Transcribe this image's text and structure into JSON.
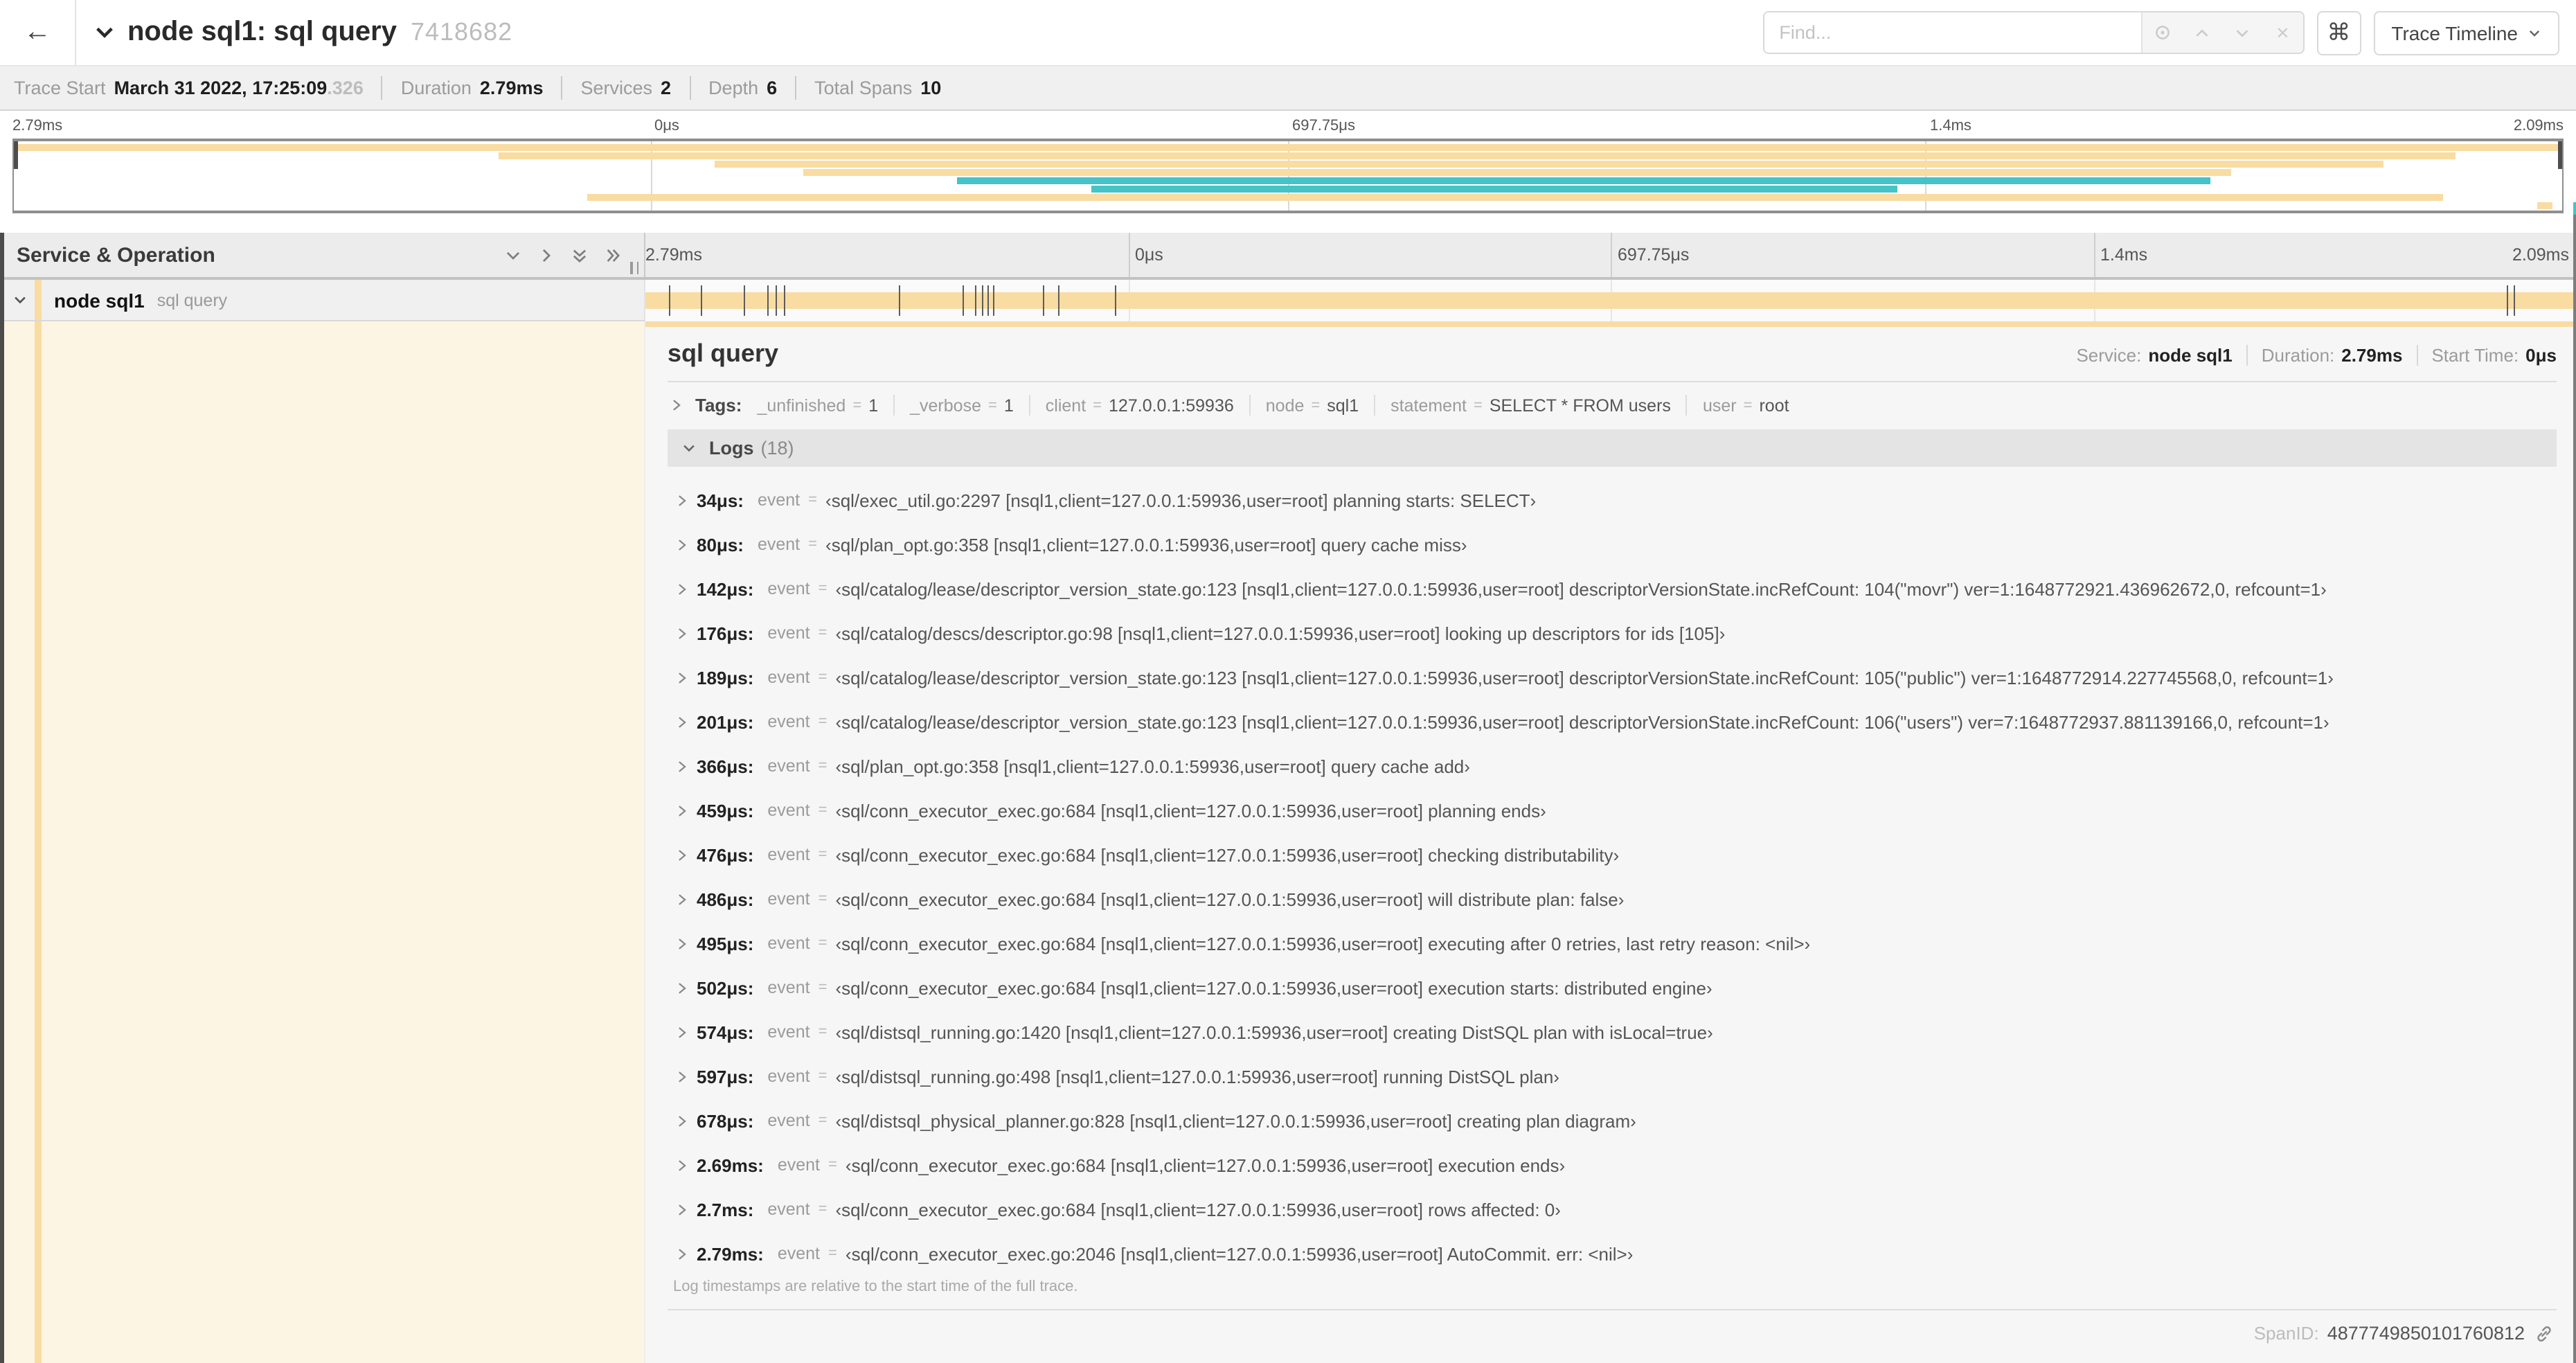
{
  "icons": {
    "back": "←",
    "command": "⌘",
    "close": "✕"
  },
  "header": {
    "title": "node sql1: sql query",
    "trace_id": "7418682",
    "find_placeholder": "Find...",
    "view_selector_label": "Trace Timeline"
  },
  "summary": {
    "items": [
      {
        "label": "Trace Start",
        "value": "March 31 2022, 17:25:09",
        "suffix": ".326"
      },
      {
        "label": "Duration",
        "value": "2.79ms"
      },
      {
        "label": "Services",
        "value": "2"
      },
      {
        "label": "Depth",
        "value": "6"
      },
      {
        "label": "Total Spans",
        "value": "10"
      }
    ]
  },
  "minimap": {
    "colors": {
      "tan": "#F8DCA1",
      "teal": "#45C3C6"
    },
    "rows": [
      {
        "start": 0,
        "end": 100,
        "color": "tan"
      },
      {
        "start": 19,
        "end": 95.8,
        "color": "tan"
      },
      {
        "start": 27.5,
        "end": 93,
        "color": "tan"
      },
      {
        "start": 31,
        "end": 87,
        "color": "tan"
      },
      {
        "start": 37,
        "end": 86.2,
        "color": "teal"
      },
      {
        "start": 42.3,
        "end": 73.9,
        "color": "teal"
      },
      {
        "start": 22.5,
        "end": 95.3,
        "color": "tan"
      },
      {
        "start": 99,
        "end": 99.6,
        "color": "tan"
      }
    ]
  },
  "timeline": {
    "column_header": "Service & Operation",
    "ticks": [
      "0μs",
      "697.75μs",
      "1.4ms",
      "2.09ms",
      "2.79ms"
    ],
    "duration_us": 2790,
    "span": {
      "service": "node sql1",
      "operation": "sql query",
      "color": "#F8DCA1"
    }
  },
  "detail": {
    "operation": "sql query",
    "meta": [
      {
        "label": "Service:",
        "value": "node sql1"
      },
      {
        "label": "Duration:",
        "value": "2.79ms"
      },
      {
        "label": "Start Time:",
        "value": "0μs"
      }
    ],
    "tags_label": "Tags:",
    "eq": "=",
    "tags": [
      {
        "key": "_unfinished",
        "value": "1"
      },
      {
        "key": "_verbose",
        "value": "1"
      },
      {
        "key": "client",
        "value": "127.0.0.1:59936"
      },
      {
        "key": "node",
        "value": "sql1"
      },
      {
        "key": "statement",
        "value": "SELECT * FROM users"
      },
      {
        "key": "user",
        "value": "root"
      }
    ],
    "logs_label": "Logs",
    "logs_count": "(18)",
    "logs": [
      {
        "time": "34μs:",
        "time_us": 34,
        "field": "event",
        "value": "‹sql/exec_util.go:2297 [nsql1,client=127.0.0.1:59936,user=root] planning starts: SELECT›"
      },
      {
        "time": "80μs:",
        "time_us": 80,
        "field": "event",
        "value": "‹sql/plan_opt.go:358 [nsql1,client=127.0.0.1:59936,user=root] query cache miss›"
      },
      {
        "time": "142μs:",
        "time_us": 142,
        "field": "event",
        "value": "‹sql/catalog/lease/descriptor_version_state.go:123 [nsql1,client=127.0.0.1:59936,user=root] descriptorVersionState.incRefCount: 104(\"movr\") ver=1:1648772921.436962672,0, refcount=1›"
      },
      {
        "time": "176μs:",
        "time_us": 176,
        "field": "event",
        "value": "‹sql/catalog/descs/descriptor.go:98 [nsql1,client=127.0.0.1:59936,user=root] looking up descriptors for ids [105]›"
      },
      {
        "time": "189μs:",
        "time_us": 189,
        "field": "event",
        "value": "‹sql/catalog/lease/descriptor_version_state.go:123 [nsql1,client=127.0.0.1:59936,user=root] descriptorVersionState.incRefCount: 105(\"public\") ver=1:1648772914.227745568,0, refcount=1›"
      },
      {
        "time": "201μs:",
        "time_us": 201,
        "field": "event",
        "value": "‹sql/catalog/lease/descriptor_version_state.go:123 [nsql1,client=127.0.0.1:59936,user=root] descriptorVersionState.incRefCount: 106(\"users\") ver=7:1648772937.881139166,0, refcount=1›"
      },
      {
        "time": "366μs:",
        "time_us": 366,
        "field": "event",
        "value": "‹sql/plan_opt.go:358 [nsql1,client=127.0.0.1:59936,user=root] query cache add›"
      },
      {
        "time": "459μs:",
        "time_us": 459,
        "field": "event",
        "value": "‹sql/conn_executor_exec.go:684 [nsql1,client=127.0.0.1:59936,user=root] planning ends›"
      },
      {
        "time": "476μs:",
        "time_us": 476,
        "field": "event",
        "value": "‹sql/conn_executor_exec.go:684 [nsql1,client=127.0.0.1:59936,user=root] checking distributability›"
      },
      {
        "time": "486μs:",
        "time_us": 486,
        "field": "event",
        "value": "‹sql/conn_executor_exec.go:684 [nsql1,client=127.0.0.1:59936,user=root] will distribute plan: false›"
      },
      {
        "time": "495μs:",
        "time_us": 495,
        "field": "event",
        "value": "‹sql/conn_executor_exec.go:684 [nsql1,client=127.0.0.1:59936,user=root] executing after 0 retries, last retry reason: <nil>›"
      },
      {
        "time": "502μs:",
        "time_us": 502,
        "field": "event",
        "value": "‹sql/conn_executor_exec.go:684 [nsql1,client=127.0.0.1:59936,user=root] execution starts: distributed engine›"
      },
      {
        "time": "574μs:",
        "time_us": 574,
        "field": "event",
        "value": "‹sql/distsql_running.go:1420 [nsql1,client=127.0.0.1:59936,user=root] creating DistSQL plan with isLocal=true›"
      },
      {
        "time": "597μs:",
        "time_us": 597,
        "field": "event",
        "value": "‹sql/distsql_running.go:498 [nsql1,client=127.0.0.1:59936,user=root] running DistSQL plan›"
      },
      {
        "time": "678μs:",
        "time_us": 678,
        "field": "event",
        "value": "‹sql/distsql_physical_planner.go:828 [nsql1,client=127.0.0.1:59936,user=root] creating plan diagram›"
      },
      {
        "time": "2.69ms:",
        "time_us": 2690,
        "field": "event",
        "value": "‹sql/conn_executor_exec.go:684 [nsql1,client=127.0.0.1:59936,user=root] execution ends›"
      },
      {
        "time": "2.7ms:",
        "time_us": 2700,
        "field": "event",
        "value": "‹sql/conn_executor_exec.go:684 [nsql1,client=127.0.0.1:59936,user=root] rows affected: 0›"
      },
      {
        "time": "2.79ms:",
        "time_us": 2790,
        "field": "event",
        "value": "‹sql/conn_executor_exec.go:2046 [nsql1,client=127.0.0.1:59936,user=root] AutoCommit. err: <nil>›"
      }
    ],
    "logs_note": "Log timestamps are relative to the start time of the full trace.",
    "span_id_label": "SpanID:",
    "span_id": "4877749850101760812"
  }
}
